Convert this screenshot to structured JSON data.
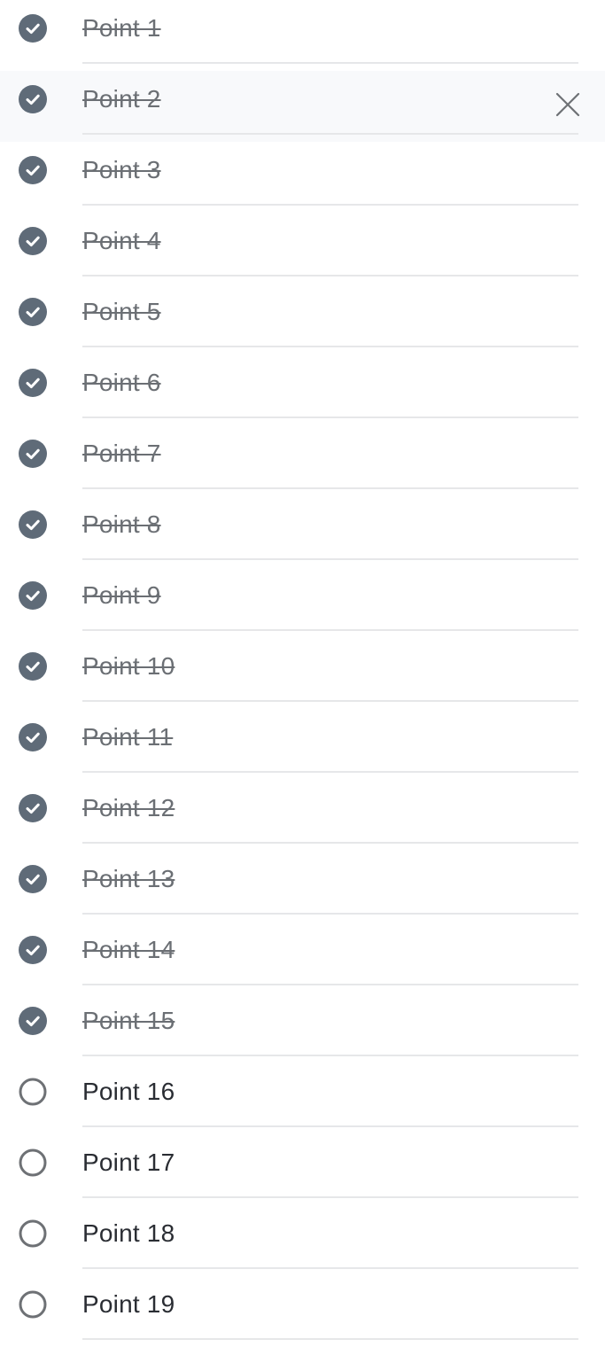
{
  "colors": {
    "check_fill": "#5f6b78",
    "open_circle": "#6e7175",
    "done_text": "#6b6f74",
    "text": "#2a2d33",
    "divider": "#e6e7e9",
    "hover_bg": "#f8f9fb"
  },
  "items": [
    {
      "label": "Point 1",
      "done": true
    },
    {
      "label": "Point 2",
      "done": true,
      "hovered": true
    },
    {
      "label": "Point 3",
      "done": true
    },
    {
      "label": "Point 4",
      "done": true
    },
    {
      "label": "Point 5",
      "done": true
    },
    {
      "label": "Point 6",
      "done": true
    },
    {
      "label": "Point 7",
      "done": true
    },
    {
      "label": "Point 8",
      "done": true
    },
    {
      "label": "Point 9",
      "done": true
    },
    {
      "label": "Point 10",
      "done": true
    },
    {
      "label": "Point 11",
      "done": true
    },
    {
      "label": "Point 12",
      "done": true
    },
    {
      "label": "Point 13",
      "done": true
    },
    {
      "label": "Point 14",
      "done": true
    },
    {
      "label": "Point 15",
      "done": true
    },
    {
      "label": "Point 16",
      "done": false
    },
    {
      "label": "Point 17",
      "done": false
    },
    {
      "label": "Point 18",
      "done": false
    },
    {
      "label": "Point 19",
      "done": false
    }
  ],
  "icons": {
    "done": "check-circle-icon",
    "open": "empty-circle-icon",
    "delete": "close-icon"
  }
}
